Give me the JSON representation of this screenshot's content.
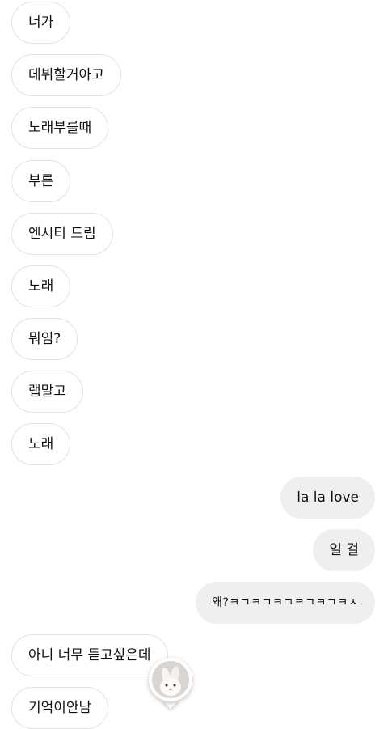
{
  "messages": [
    {
      "side": "in",
      "text": "너가"
    },
    {
      "side": "in",
      "text": "데뷔할거아고"
    },
    {
      "side": "in",
      "text": "노래부를때"
    },
    {
      "side": "in",
      "text": "부른"
    },
    {
      "side": "in",
      "text": "엔시티 드림"
    },
    {
      "side": "in",
      "text": "노래"
    },
    {
      "side": "in",
      "text": "뭐임?"
    },
    {
      "side": "in",
      "text": "랩말고"
    },
    {
      "side": "in",
      "text": "노래"
    },
    {
      "side": "out",
      "text": "la la love"
    },
    {
      "side": "out",
      "text": "일 걸"
    },
    {
      "side": "out",
      "text": "왜?ㅋㄱㅋㄱㅋㄱㅋㄱㅋㄱㅋㅅ"
    },
    {
      "side": "in",
      "text": "아니 너무 듣고싶은데"
    },
    {
      "side": "in",
      "text": "기억이안남"
    }
  ],
  "seen_avatar": {
    "icon": "bunny-avatar-icon"
  },
  "colors": {
    "incoming_border": "#e2e2e2",
    "outgoing_bg": "#efefef",
    "text": "#111111"
  }
}
